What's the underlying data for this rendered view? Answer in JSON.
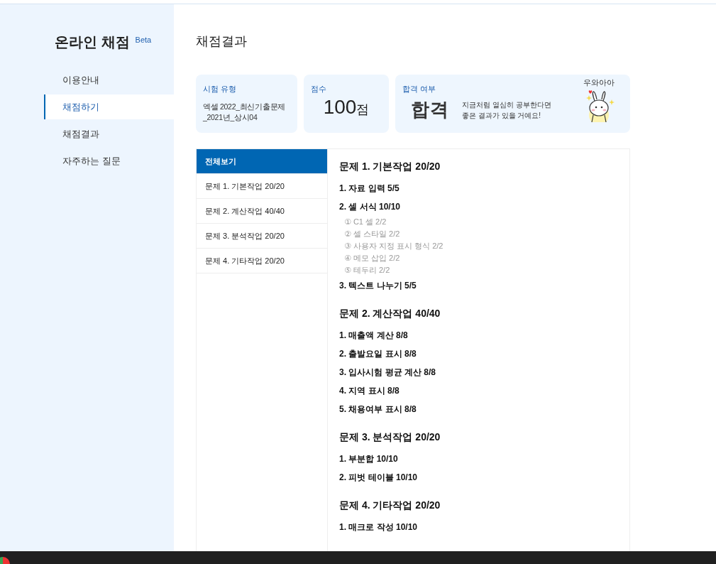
{
  "app": {
    "title": "온라인 채점",
    "badge": "Beta"
  },
  "nav": [
    {
      "label": "이용안내",
      "selected": false
    },
    {
      "label": "채점하기",
      "selected": true
    },
    {
      "label": "채점결과",
      "selected": false
    },
    {
      "label": "자주하는 질문",
      "selected": false
    }
  ],
  "page_title": "채점결과",
  "cards": {
    "exam_type": {
      "label": "시험 유형",
      "lines": [
        "엑셀 2022_최신기출문제",
        "_2021년_상시04"
      ]
    },
    "score": {
      "label": "점수",
      "value": "100",
      "unit": "점"
    },
    "result": {
      "label": "합격 여부",
      "value": "합격",
      "message": [
        "지금처럼 열심히 공부한다면",
        "좋은 결과가 있을 거예요!"
      ],
      "sticker_text": "우와아아"
    }
  },
  "question_list": [
    {
      "label": "전체보기",
      "selected": true
    },
    {
      "label": "문제 1. 기본작업 20/20",
      "selected": false
    },
    {
      "label": "문제 2. 계산작업 40/40",
      "selected": false
    },
    {
      "label": "문제 3. 분석작업 20/20",
      "selected": false
    },
    {
      "label": "문제 4. 기타작업 20/20",
      "selected": false
    }
  ],
  "results": [
    {
      "title": "문제 1. 기본작업 20/20",
      "items": [
        {
          "label": "1. 자료 입력 5/5"
        },
        {
          "label": "2. 셀 서식 10/10",
          "children": [
            "① C1 셀 2/2",
            "② 셀 스타일 2/2",
            "③ 사용자 지정 표시 형식 2/2",
            "④ 메모 삽입 2/2",
            "⑤ 테두리 2/2"
          ]
        },
        {
          "label": "3. 텍스트 나누기 5/5"
        }
      ]
    },
    {
      "title": "문제 2. 계산작업 40/40",
      "items": [
        {
          "label": "1. 매출액 계산 8/8"
        },
        {
          "label": "2. 출발요일 표시 8/8"
        },
        {
          "label": "3. 입사시험 평균 계산 8/8"
        },
        {
          "label": "4. 지역 표시 8/8"
        },
        {
          "label": "5. 채용여부 표시 8/8"
        }
      ]
    },
    {
      "title": "문제 3. 분석작업 20/20",
      "items": [
        {
          "label": "1. 부분합 10/10"
        },
        {
          "label": "2. 피벗 테이블 10/10"
        }
      ]
    },
    {
      "title": "문제 4. 기타작업 20/20",
      "items": [
        {
          "label": "1. 매크로 작성 10/10"
        }
      ]
    }
  ]
}
